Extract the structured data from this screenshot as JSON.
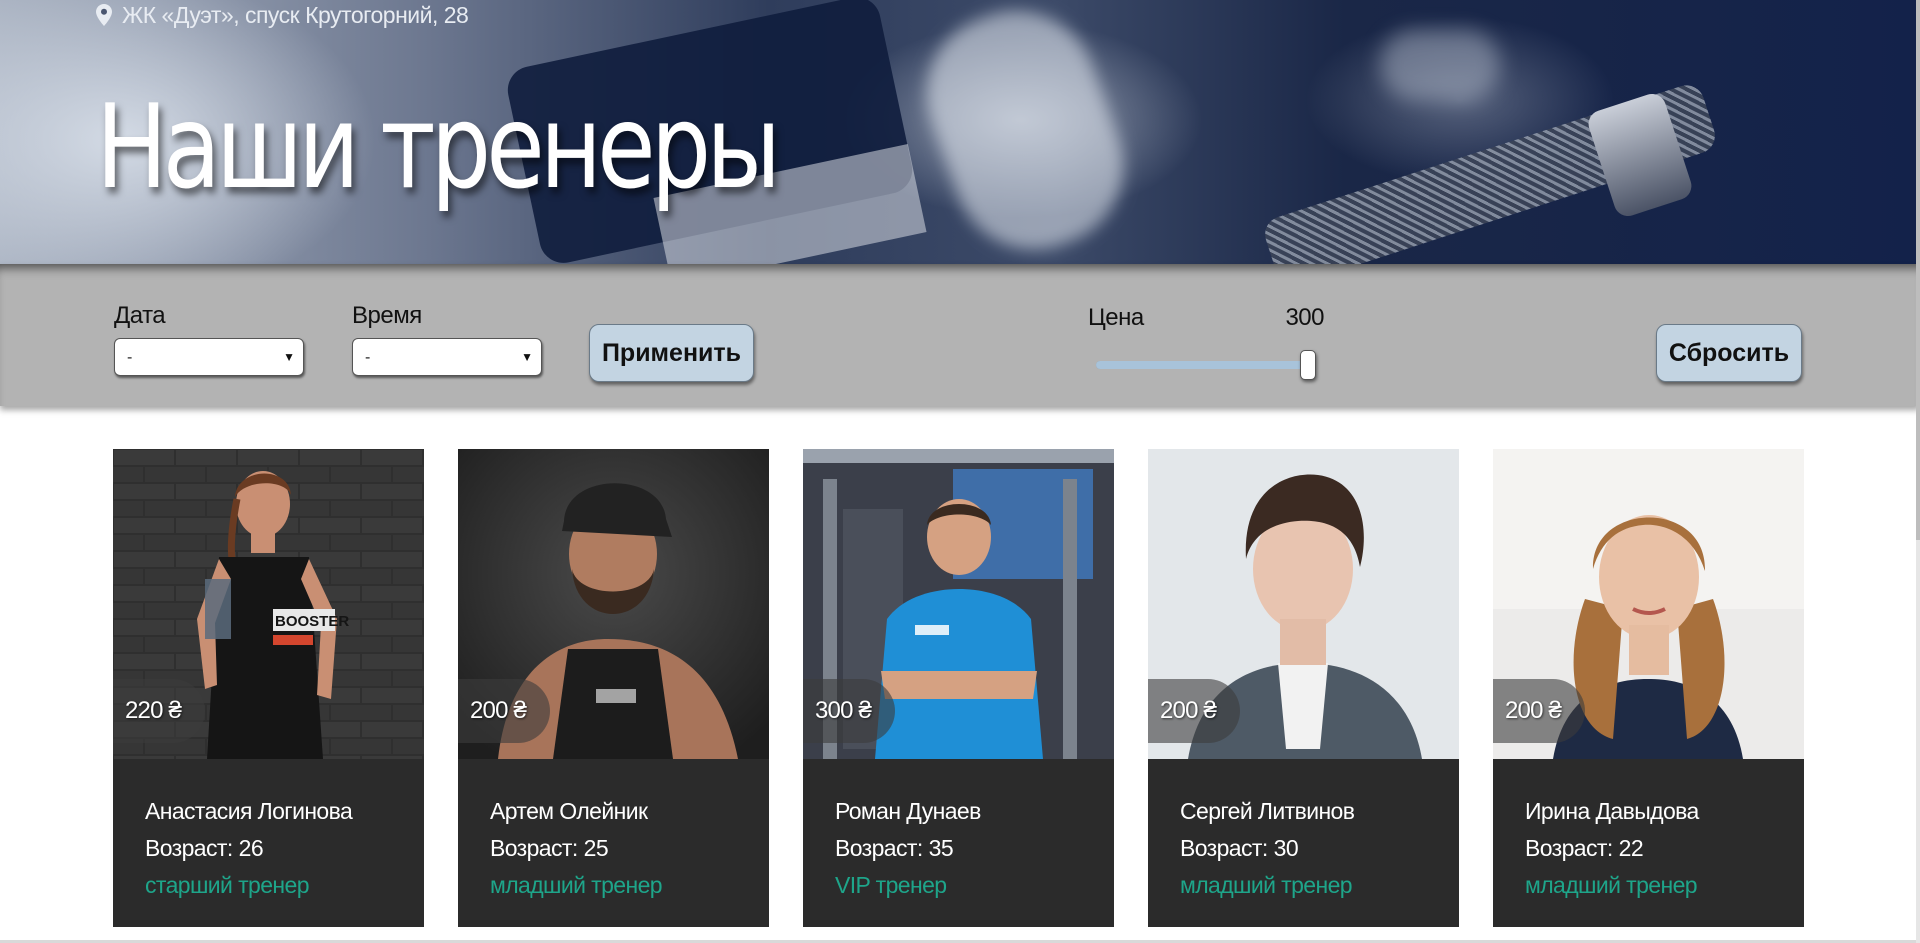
{
  "hero": {
    "location_icon": "map-pin-icon",
    "location": "ЖК «Дуэт», спуск Крутогорний, 28",
    "title": "Наши тренеры"
  },
  "filters": {
    "date_label": "Дата",
    "date_value": "-",
    "time_label": "Время",
    "time_value": "-",
    "apply_label": "Применить",
    "price_label": "Цена",
    "price_value": "300",
    "price_slider_fraction": 1.0,
    "reset_label": "Сбросить"
  },
  "age_prefix": "Возраст:",
  "trainers": [
    {
      "price": "220 ₴",
      "name": "Анастасия Логинова",
      "age": "26",
      "rank": "старший тренер"
    },
    {
      "price": "200 ₴",
      "name": "Артем Олейник",
      "age": "25",
      "rank": "младший тренер"
    },
    {
      "price": "300 ₴",
      "name": "Роман Дунаев",
      "age": "35",
      "rank": "VIP тренер"
    },
    {
      "price": "200 ₴",
      "name": "Сергей Литвинов",
      "age": "30",
      "rank": "младший тренер"
    },
    {
      "price": "200 ₴",
      "name": "Ирина Давыдова",
      "age": "22",
      "rank": "младший тренер"
    }
  ],
  "colors": {
    "rank_accent": "#1ea58a",
    "card_bg": "#2b2b2b",
    "filter_bar_bg": "#b3b3b3",
    "button_bg": "#c3d4e2"
  }
}
